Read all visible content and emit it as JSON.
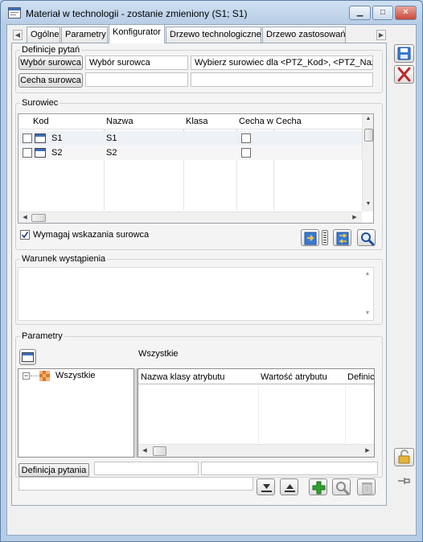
{
  "window": {
    "title": "Materiał w technologii - zostanie zmieniony  (S1; S1)",
    "minimize": "▁",
    "maximize": "□",
    "close": "✕"
  },
  "tabs": [
    {
      "label": "Ogólne"
    },
    {
      "label": "Parametry"
    },
    {
      "label": "Konfigurator"
    },
    {
      "label": "Drzewo technologiczne"
    },
    {
      "label": "Drzewo zastosowań"
    }
  ],
  "definicje": {
    "legend": "Definicje pytań",
    "wybor_button": "Wybór surowca",
    "wybor_value": "Wybór surowca",
    "wybor_text": "Wybierz surowiec dla <PTZ_Kod>, <PTZ_Naz",
    "cecha_button": "Cecha surowca",
    "cecha_value": "",
    "cecha_text": ""
  },
  "surowiec": {
    "legend": "Surowiec",
    "columns": [
      "Kod",
      "Nazwa",
      "Klasa",
      "Cecha w",
      "Cecha"
    ],
    "rows": [
      {
        "kod": "S1",
        "nazwa": "S1",
        "klasa": "",
        "cecha": ""
      },
      {
        "kod": "S2",
        "nazwa": "S2",
        "klasa": "",
        "cecha": ""
      }
    ],
    "require_label": "Wymagaj wskazania surowca",
    "require_checked": true
  },
  "warunek": {
    "legend": "Warunek wystąpienia",
    "text": ""
  },
  "parametry": {
    "legend": "Parametry",
    "header_label": "Wszystkie",
    "tree_root": "Wszystkie",
    "tree_expander": "−",
    "columns": [
      "Nazwa klasy atrybutu",
      "Wartość atrybutu",
      "Definic"
    ],
    "definicja_button": "Definicja pytania",
    "definicja_value1": "",
    "definicja_value2": "",
    "bottom_field": ""
  },
  "colors": {
    "accent": "#3a7bd5",
    "delete_red": "#c0282b",
    "add_green": "#2ea02e"
  }
}
